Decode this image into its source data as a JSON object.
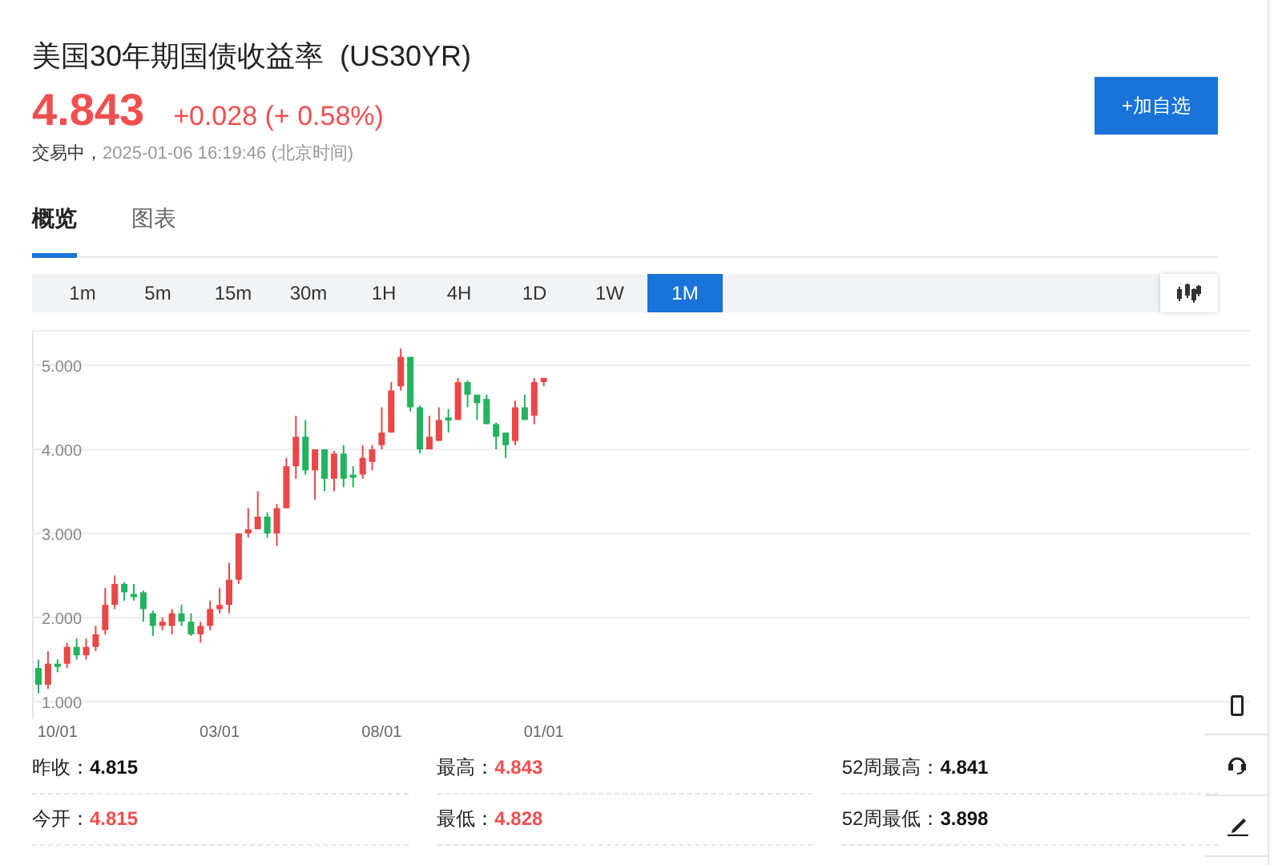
{
  "header": {
    "title": "美国30年期国债收益率  (US30YR)",
    "price": "4.843",
    "change": "+0.028 (+ 0.58%)",
    "status": "交易中，",
    "time": "2025-01-06 16:19:46 (北京时间)",
    "watch_button": "+加自选"
  },
  "tabs": [
    {
      "label": "概览",
      "selected": true
    },
    {
      "label": "图表",
      "selected": false
    }
  ],
  "intervals": [
    {
      "label": "1m",
      "selected": false
    },
    {
      "label": "5m",
      "selected": false
    },
    {
      "label": "15m",
      "selected": false
    },
    {
      "label": "30m",
      "selected": false
    },
    {
      "label": "1H",
      "selected": false
    },
    {
      "label": "4H",
      "selected": false
    },
    {
      "label": "1D",
      "selected": false
    },
    {
      "label": "1W",
      "selected": false
    },
    {
      "label": "1M",
      "selected": true
    }
  ],
  "chart": {
    "chart_data": {
      "type": "candlestick",
      "categories": [
        null,
        null,
        "10/01",
        null,
        null,
        null,
        null,
        null,
        null,
        null,
        null,
        null,
        null,
        null,
        null,
        null,
        null,
        null,
        null,
        "03/01",
        null,
        null,
        null,
        null,
        null,
        null,
        null,
        null,
        null,
        null,
        null,
        null,
        null,
        null,
        null,
        null,
        "08/01",
        null,
        null,
        null,
        null,
        null,
        null,
        null,
        null,
        null,
        null,
        null,
        null,
        null,
        null,
        null,
        null,
        "01/01"
      ],
      "ylim": [
        0.79,
        5.42
      ],
      "grid": true,
      "ohlc": [
        [
          1.4,
          1.5,
          1.1,
          1.2
        ],
        [
          1.2,
          1.6,
          1.15,
          1.45
        ],
        [
          1.45,
          1.5,
          1.35,
          1.42
        ],
        [
          1.45,
          1.7,
          1.4,
          1.65
        ],
        [
          1.65,
          1.75,
          1.5,
          1.55
        ],
        [
          1.55,
          1.75,
          1.5,
          1.65
        ],
        [
          1.65,
          1.9,
          1.6,
          1.8
        ],
        [
          1.85,
          2.35,
          1.8,
          2.15
        ],
        [
          2.15,
          2.5,
          2.1,
          2.4
        ],
        [
          2.4,
          2.42,
          2.2,
          2.3
        ],
        [
          2.28,
          2.4,
          2.2,
          2.25
        ],
        [
          2.3,
          2.32,
          1.95,
          2.1
        ],
        [
          2.05,
          2.08,
          1.78,
          1.9
        ],
        [
          1.9,
          2.0,
          1.85,
          1.95
        ],
        [
          1.9,
          2.1,
          1.8,
          2.05
        ],
        [
          2.05,
          2.15,
          1.9,
          1.95
        ],
        [
          1.95,
          2.05,
          1.78,
          1.8
        ],
        [
          1.8,
          1.95,
          1.7,
          1.9
        ],
        [
          1.9,
          2.2,
          1.85,
          2.1
        ],
        [
          2.1,
          2.35,
          2.05,
          2.15
        ],
        [
          2.15,
          2.65,
          2.05,
          2.45
        ],
        [
          2.45,
          3.0,
          2.4,
          3.0
        ],
        [
          3.0,
          3.3,
          2.95,
          3.05
        ],
        [
          3.05,
          3.5,
          3.05,
          3.2
        ],
        [
          3.2,
          3.25,
          2.95,
          3.0
        ],
        [
          3.0,
          3.35,
          2.85,
          3.3
        ],
        [
          3.3,
          3.9,
          3.3,
          3.8
        ],
        [
          3.8,
          4.4,
          3.65,
          4.15
        ],
        [
          4.15,
          4.35,
          3.7,
          3.75
        ],
        [
          3.75,
          4.0,
          3.4,
          4.0
        ],
        [
          4.0,
          4.0,
          3.5,
          3.65
        ],
        [
          3.65,
          3.98,
          3.5,
          3.95
        ],
        [
          3.95,
          4.05,
          3.55,
          3.65
        ],
        [
          3.7,
          3.8,
          3.55,
          3.68
        ],
        [
          3.7,
          4.05,
          3.65,
          3.9
        ],
        [
          3.85,
          4.05,
          3.75,
          4.0
        ],
        [
          4.05,
          4.5,
          4.0,
          4.2
        ],
        [
          4.2,
          4.8,
          4.2,
          4.7
        ],
        [
          4.75,
          5.2,
          4.7,
          5.1
        ],
        [
          5.1,
          5.1,
          4.45,
          4.5
        ],
        [
          4.5,
          4.52,
          3.95,
          4.0
        ],
        [
          4.0,
          4.4,
          4.0,
          4.15
        ],
        [
          4.1,
          4.5,
          4.1,
          4.35
        ],
        [
          4.38,
          4.48,
          4.2,
          4.35
        ],
        [
          4.35,
          4.85,
          4.35,
          4.8
        ],
        [
          4.8,
          4.82,
          4.5,
          4.65
        ],
        [
          4.65,
          4.65,
          4.35,
          4.55
        ],
        [
          4.6,
          4.65,
          4.3,
          4.3
        ],
        [
          4.3,
          4.32,
          4.0,
          4.15
        ],
        [
          4.2,
          4.2,
          3.9,
          4.05
        ],
        [
          4.1,
          4.58,
          4.05,
          4.5
        ],
        [
          4.5,
          4.65,
          4.35,
          4.35
        ],
        [
          4.4,
          4.85,
          4.3,
          4.8
        ],
        [
          4.8,
          4.85,
          4.75,
          4.85
        ]
      ],
      "yticks": [
        {
          "value": 5,
          "label": "5.000"
        },
        {
          "value": 4,
          "label": "4.000"
        },
        {
          "value": 3,
          "label": "3.000"
        },
        {
          "value": 2,
          "label": "2.000"
        },
        {
          "value": 1,
          "label": "1.000"
        }
      ]
    }
  },
  "stats": [
    {
      "label": "昨收：",
      "value": "4.815",
      "color": "#111111"
    },
    {
      "label": "最高：",
      "value": "4.843",
      "color": "#f04f4f"
    },
    {
      "label": "52周最高：",
      "value": "4.841",
      "color": "#111111"
    },
    {
      "label": "今开：",
      "value": "4.815",
      "color": "#f04f4f"
    },
    {
      "label": "最低：",
      "value": "4.828",
      "color": "#f04f4f"
    },
    {
      "label": "52周最低：",
      "value": "3.898",
      "color": "#111111"
    }
  ]
}
